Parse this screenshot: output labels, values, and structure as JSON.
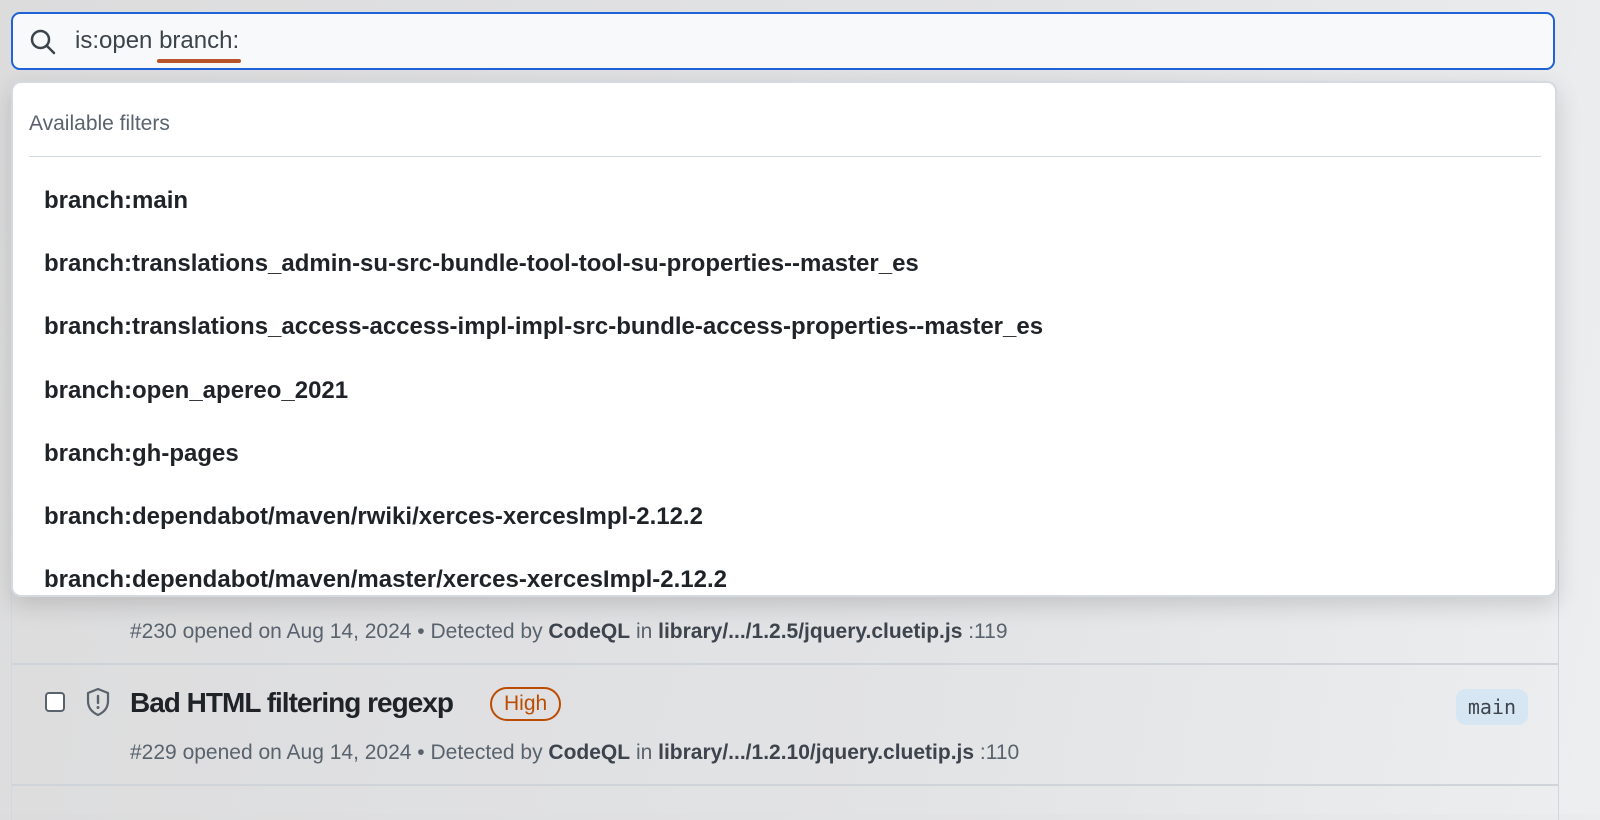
{
  "search": {
    "query_prefix": "is:open ",
    "query_token": "branch:",
    "icon": "search-icon"
  },
  "dropdown": {
    "heading": "Available filters",
    "options": [
      "branch:main",
      "branch:translations_admin-su-src-bundle-tool-tool-su-properties--master_es",
      "branch:translations_access-access-impl-impl-src-bundle-access-properties--master_es",
      "branch:open_apereo_2021",
      "branch:gh-pages",
      "branch:dependabot/maven/rwiki/xerces-xercesImpl-2.12.2",
      "branch:dependabot/maven/master/xerces-xercesImpl-2.12.2"
    ]
  },
  "alerts": [
    {
      "number": "#230",
      "opened": "opened on Aug 14, 2024",
      "sep": "•",
      "detected_by_label": "Detected by",
      "tool": "CodeQL",
      "in_label": "in",
      "path": "library/.../1.2.5/jquery.cluetip.js",
      "line": ":119"
    },
    {
      "title": "Bad HTML filtering regexp",
      "severity": "High",
      "branch": "main",
      "number": "#229",
      "opened": "opened on Aug 14, 2024",
      "sep": "•",
      "detected_by_label": "Detected by",
      "tool": "CodeQL",
      "in_label": "in",
      "path": "library/.../1.2.10/jquery.cluetip.js",
      "line": ":110"
    }
  ],
  "colors": {
    "focus": "#1f63d6",
    "underline": "#b8542a",
    "severity_high": "#bc4c00",
    "branch_bg": "#d6e6f2"
  }
}
